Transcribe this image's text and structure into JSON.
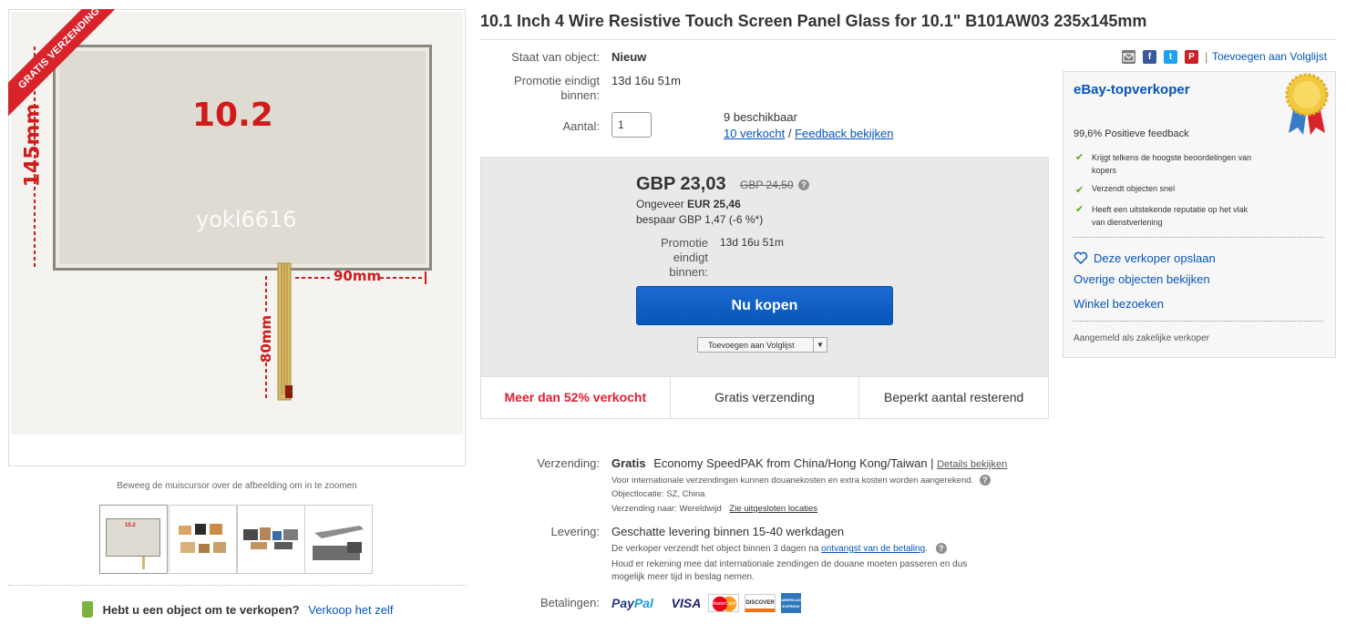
{
  "gallery": {
    "ribbon_text": "GRATIS VERZENDING",
    "photo": {
      "panel_label": "10.2",
      "watermark": "yokl6616",
      "dim_height": "145mm",
      "dim_width": "90mm",
      "dim_cable": "80mm"
    },
    "zoom_hint": "Beweeg de muiscursor over de afbeelding om in te zoomen",
    "thumb1_label": "10.2"
  },
  "sell": {
    "prompt": "Hebt u een object om te verkopen?",
    "link": "Verkoop het zelf"
  },
  "title": "10.1 Inch 4 Wire Resistive Touch Screen Panel Glass for 10.1\" B101AW03 235x145mm",
  "details": {
    "condition_label": "Staat van object:",
    "condition_value": "Nieuw",
    "promo_label_1": "Promotie eindigt",
    "promo_label_2": "binnen:",
    "promo_value": "13d 16u 51m",
    "qty_label": "Aantal:",
    "qty_value": "1",
    "available": "9 beschikbaar",
    "sold_link": "10 verkocht",
    "separator": "/",
    "feedback_link": "Feedback bekijken"
  },
  "buybox": {
    "price": "GBP 23,03",
    "orig_price": "GBP 24,50",
    "approx_label": "Ongeveer",
    "approx_value": "EUR 25,46",
    "savings": "bespaar GBP 1,47 (-6 %*)",
    "promo_label_1": "Promotie",
    "promo_label_2": "eindigt",
    "promo_label_3": "binnen:",
    "promo_value": "13d 16u 51m",
    "buy_now": "Nu kopen",
    "watchlist": "Toevoegen aan Volglijst"
  },
  "hotness": {
    "sold_pct": "Meer dan 52% verkocht",
    "free_shipping": "Gratis verzending",
    "limited": "Beperkt aantal resterend"
  },
  "shipping": {
    "label": "Verzending:",
    "free": "Gratis",
    "service": "Economy SpeedPAK from China/Hong Kong/Taiwan |",
    "details_link": "Details bekijken",
    "customs_note": "Voor internationale verzendingen kunnen douanekosten en extra kosten worden aangerekend.",
    "location": "Objectlocatie:  SZ, China",
    "ships_to": "Verzending naar:  Wereldwijd",
    "excluded_link": "Zie uitgesloten locaties"
  },
  "delivery": {
    "label": "Levering:",
    "estimate": "Geschatte levering binnen 15-40 werkdagen",
    "note_prefix": "De verkoper verzendt het object binnen 3 dagen na",
    "note_link": "ontvangst van de betaling",
    "note_suffix": ".",
    "customs_1": "Houd er rekening mee dat internationale zendingen de douane moeten passeren en dus",
    "customs_2": "mogelijk meer tijd in beslag nemen."
  },
  "payment": {
    "label": "Betalingen:",
    "paypal_pay": "Pay",
    "paypal_pal": "Pal",
    "visa": "VISA",
    "mastercard": "MasterCard",
    "discover": "DISCOVER",
    "amex": "AMERICAN EXPRESS"
  },
  "share": {
    "watch_link": "Toevoegen aan Volglijst",
    "pipe": "|",
    "facebook": "f",
    "twitter": "t",
    "pinterest": "P"
  },
  "seller": {
    "badge_title": "eBay-topverkoper",
    "feedback": "99,6% Positieve feedback",
    "points": [
      [
        "Krijgt telkens de hoogste beoordelingen van",
        "kopers"
      ],
      [
        "Verzendt objecten snel"
      ],
      [
        "Heeft een uitstekende reputatie op het vlak",
        "van dienstverlening"
      ]
    ],
    "save_seller": "Deze verkoper opslaan",
    "other_items": "Overige objecten bekijken",
    "store": "Winkel bezoeken",
    "business": "Aangemeld als zakelijke verkoper"
  }
}
